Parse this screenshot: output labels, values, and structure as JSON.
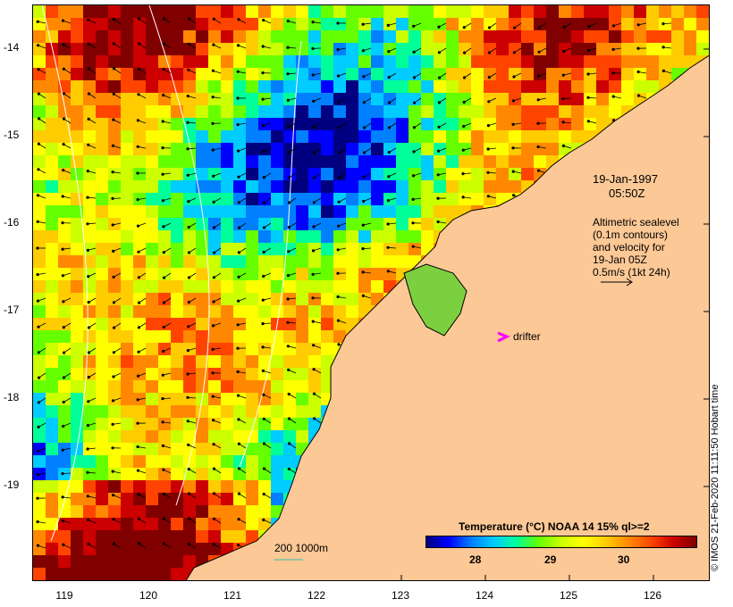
{
  "map": {
    "annotation_date": "19-Jan-1997",
    "annotation_time": "05:50Z",
    "altimetric_lines": [
      "Altimetric sealevel",
      "(0.1m contours)",
      "and velocity for",
      "19-Jan 05Z",
      "0.5m/s (1kt 24h)"
    ],
    "drifter_label": "drifter",
    "scale_label": "200  1000m",
    "credit": "© IMOS 21-Feb-2020 11:11:50 Hobart time",
    "y_axis_labels": [
      "-14",
      "-15",
      "-16",
      "-17",
      "-18",
      "-19"
    ],
    "x_axis_labels": [
      "119",
      "120",
      "121",
      "122",
      "123",
      "124",
      "125",
      "126"
    ]
  },
  "colorbar": {
    "title": "Temperature (°C) NOAA 14 15% ql>=2",
    "tick_labels": [
      "28",
      "29",
      "30"
    ],
    "colors": [
      "#000080",
      "#0000ff",
      "#0080ff",
      "#00ccff",
      "#00ff99",
      "#66ff00",
      "#ccff00",
      "#ffff00",
      "#ffcc00",
      "#ff8800",
      "#ff4400",
      "#cc0000",
      "#800000"
    ]
  },
  "colors": {
    "land": "#fcc896",
    "coastline": "#000000",
    "contour": "#ffffff",
    "drifter": "#ff00ff",
    "scale_bar": "#33bbaa"
  }
}
